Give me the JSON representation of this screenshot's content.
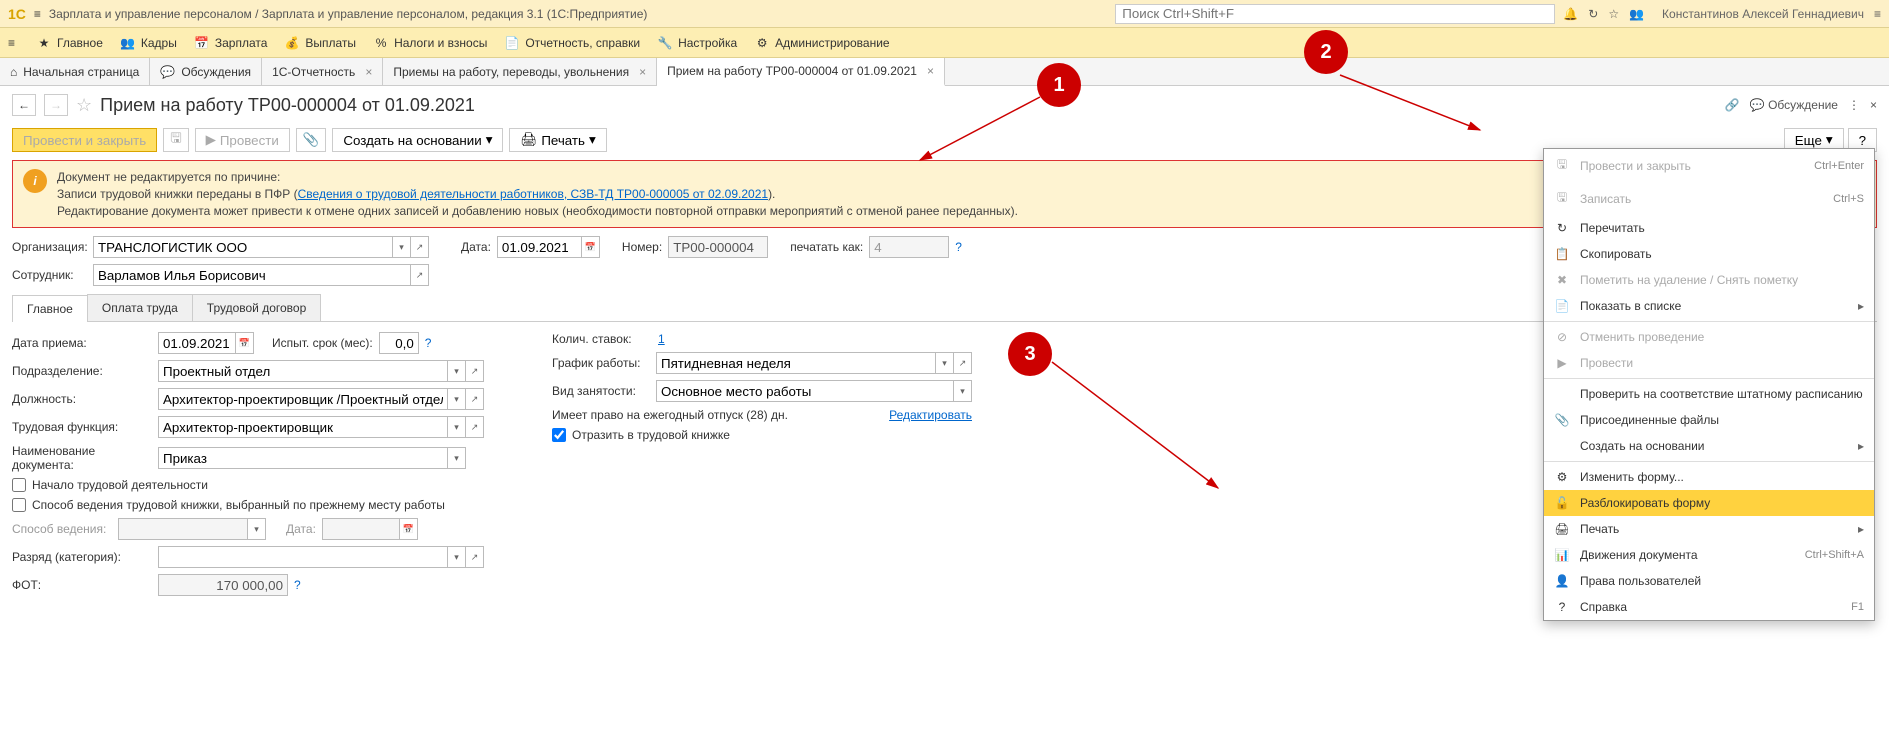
{
  "titlebar": {
    "app_title": "Зарплата и управление персоналом / Зарплата и управление персоналом, редакция 3.1  (1С:Предприятие)",
    "search_placeholder": "Поиск Ctrl+Shift+F",
    "user_name": "Константинов Алексей Геннадиевич"
  },
  "mainmenu": {
    "items": [
      {
        "icon": "star",
        "label": "Главное"
      },
      {
        "icon": "people",
        "label": "Кадры"
      },
      {
        "icon": "calc",
        "label": "Зарплата"
      },
      {
        "icon": "money",
        "label": "Выплаты"
      },
      {
        "icon": "percent",
        "label": "Налоги и взносы"
      },
      {
        "icon": "report",
        "label": "Отчетность, справки"
      },
      {
        "icon": "wrench",
        "label": "Настройка"
      },
      {
        "icon": "gear",
        "label": "Администрирование"
      }
    ]
  },
  "tabsbar": {
    "home": "Начальная страница",
    "tabs": [
      {
        "label": "Обсуждения"
      },
      {
        "label": "1С-Отчетность"
      },
      {
        "label": "Приемы на работу, переводы, увольнения"
      },
      {
        "label": "Прием на работу ТР00-000004 от 01.09.2021",
        "active": true
      }
    ]
  },
  "dochdr": {
    "title": "Прием на работу ТР00-000004 от 01.09.2021",
    "discuss": "Обсуждение"
  },
  "toolbar": {
    "post_close": "Провести и закрыть",
    "post": "Провести",
    "create_based": "Создать на основании",
    "print": "Печать",
    "more": "Еще",
    "help": "?"
  },
  "warn": {
    "line1": "Документ не редактируется по причине:",
    "line2a": "Записи трудовой книжки переданы в ПФР (",
    "link": "Сведения о трудовой деятельности работников, СЗВ-ТД ТР00-000005 от 02.09.2021",
    "line2b": ").",
    "line3": "Редактирование документа может привести к отмене одних записей и добавлению новых (необходимости повторной отправки мероприятий с отменой ранее переданных)."
  },
  "form": {
    "org_label": "Организация:",
    "org_value": "ТРАНСЛОГИСТИК ООО",
    "date_label": "Дата:",
    "date_value": "01.09.2021",
    "num_label": "Номер:",
    "num_value": "ТР00-000004",
    "print_as_label": "печатать как:",
    "print_as_value": "4",
    "emp_label": "Сотрудник:",
    "emp_value": "Варламов Илья Борисович",
    "tabs": [
      "Главное",
      "Оплата труда",
      "Трудовой договор"
    ],
    "hire_date_label": "Дата приема:",
    "hire_date_value": "01.09.2021",
    "trial_label": "Испыт. срок (мес):",
    "trial_value": "0,0",
    "dept_label": "Подразделение:",
    "dept_value": "Проектный отдел",
    "pos_label": "Должность:",
    "pos_value": "Архитектор-проектировщик /Проектный отдел/",
    "func_label": "Трудовая функция:",
    "func_value": "Архитектор-проектировщик",
    "docname_label": "Наименование документа:",
    "docname_value": "Приказ",
    "chk_start": "Начало трудовой деятельности",
    "chk_method": "Способ ведения трудовой книжки, выбранный по прежнему месту работы",
    "method_label": "Способ ведения:",
    "method_date_label": "Дата:",
    "rank_label": "Разряд (категория):",
    "fot_label": "ФОТ:",
    "fot_value": "170 000,00",
    "rates_label": "Колич. ставок:",
    "rates_value": "1",
    "schedule_label": "График работы:",
    "schedule_value": "Пятидневная неделя",
    "emptype_label": "Вид занятости:",
    "emptype_value": "Основное место работы",
    "vacation_text": "Имеет право на ежегодный отпуск (28) дн.",
    "vacation_edit": "Редактировать",
    "chk_workbook": "Отразить в трудовой книжке"
  },
  "moremenu": {
    "items": [
      {
        "icon": "🖫",
        "label": "Провести и закрыть",
        "short": "Ctrl+Enter",
        "disabled": true
      },
      {
        "icon": "🖫",
        "label": "Записать",
        "short": "Ctrl+S",
        "disabled": true
      },
      {
        "icon": "↻",
        "label": "Перечитать"
      },
      {
        "icon": "📋",
        "label": "Скопировать"
      },
      {
        "icon": "✖",
        "label": "Пометить на удаление / Снять пометку",
        "disabled": true
      },
      {
        "icon": "📄",
        "label": "Показать в списке",
        "arrow": true
      },
      {
        "sep": true
      },
      {
        "icon": "⊘",
        "label": "Отменить проведение",
        "disabled": true
      },
      {
        "icon": "▶",
        "label": "Провести",
        "disabled": true
      },
      {
        "sep": true
      },
      {
        "icon": "",
        "label": "Проверить на соответствие штатному расписанию"
      },
      {
        "icon": "📎",
        "label": "Присоединенные файлы"
      },
      {
        "icon": "",
        "label": "Создать на основании",
        "arrow": true
      },
      {
        "sep": true
      },
      {
        "icon": "⚙",
        "label": "Изменить форму..."
      },
      {
        "icon": "🔓",
        "label": "Разблокировать форму",
        "hl": true
      },
      {
        "icon": "🖨",
        "label": "Печать",
        "arrow": true
      },
      {
        "icon": "📊",
        "label": "Движения документа",
        "short": "Ctrl+Shift+A"
      },
      {
        "icon": "👤",
        "label": "Права пользователей"
      },
      {
        "icon": "?",
        "label": "Справка",
        "short": "F1"
      }
    ]
  },
  "callouts": {
    "c1": "1",
    "c2": "2",
    "c3": "3"
  }
}
